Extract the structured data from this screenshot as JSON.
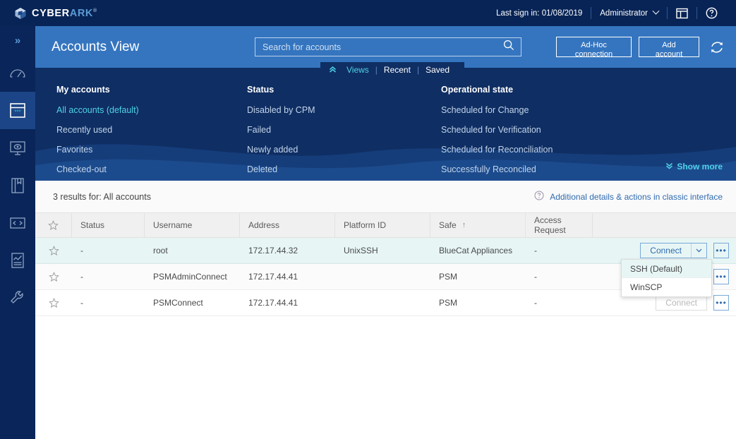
{
  "brand": {
    "name_white": "CYBER",
    "name_accent": "ARK",
    "trademark": "®",
    "accent_color": "#5b9bd5",
    "bar_color": "#082456"
  },
  "topbar": {
    "last_sign_in": "Last sign in: 01/08/2019",
    "user": "Administrator",
    "layout_icon": "panel-layout-icon",
    "help_icon": "help-circle-icon"
  },
  "sidebar": {
    "expand_glyph": "»",
    "items": [
      {
        "name": "dashboard",
        "icon": "gauge-icon",
        "active": false
      },
      {
        "name": "accounts",
        "icon": "accounts-window-icon",
        "active": true
      },
      {
        "name": "monitoring",
        "icon": "monitor-eye-icon",
        "active": false
      },
      {
        "name": "reports",
        "icon": "book-icon",
        "active": false
      },
      {
        "name": "api",
        "icon": "code-brackets-icon",
        "active": false
      },
      {
        "name": "analytics",
        "icon": "chart-document-icon",
        "active": false
      },
      {
        "name": "tools",
        "icon": "wrench-icon",
        "active": false
      }
    ]
  },
  "header": {
    "title": "Accounts View",
    "accent_color": "#3575bf",
    "search": {
      "placeholder": "Search for accounts",
      "value": ""
    },
    "adhoc_button": "Ad-Hoc\nconnection",
    "adhoc_line1": "Ad-Hoc",
    "adhoc_line2": "connection",
    "add_line1": "Add",
    "add_line2": "account",
    "refresh_icon": "refresh-icon"
  },
  "tabs": {
    "items": [
      {
        "label": "Views",
        "active": true
      },
      {
        "label": "Recent",
        "active": false
      },
      {
        "label": "Saved",
        "active": false
      }
    ],
    "separator": "|",
    "active_color": "#4fd2e8"
  },
  "views_panel": {
    "background": "#0f2e63",
    "columns": [
      {
        "header": "My accounts",
        "items": [
          {
            "label": "All accounts (default)",
            "active": true
          },
          {
            "label": "Recently used",
            "active": false
          },
          {
            "label": "Favorites",
            "active": false
          },
          {
            "label": "Checked-out",
            "active": false
          }
        ]
      },
      {
        "header": "Status",
        "items": [
          {
            "label": "Disabled by CPM",
            "active": false
          },
          {
            "label": "Failed",
            "active": false
          },
          {
            "label": "Newly added",
            "active": false
          },
          {
            "label": "Deleted",
            "active": false
          }
        ]
      },
      {
        "header": "Operational state",
        "items": [
          {
            "label": "Scheduled for Change",
            "active": false
          },
          {
            "label": "Scheduled for Verification",
            "active": false
          },
          {
            "label": "Scheduled for Reconciliation",
            "active": false
          },
          {
            "label": "Successfully Reconciled",
            "active": false
          }
        ]
      }
    ],
    "show_more": "Show more"
  },
  "results": {
    "summary": "3 results  for: All accounts",
    "classic_link": "Additional details & actions in classic interface"
  },
  "table": {
    "columns": [
      {
        "key": "favorite",
        "label": "",
        "icon": "star-icon"
      },
      {
        "key": "status",
        "label": "Status"
      },
      {
        "key": "username",
        "label": "Username"
      },
      {
        "key": "address",
        "label": "Address"
      },
      {
        "key": "platform_id",
        "label": "Platform ID"
      },
      {
        "key": "safe",
        "label": "Safe",
        "sort": "↑"
      },
      {
        "key": "access_request",
        "label": "Access Request"
      },
      {
        "key": "actions",
        "label": ""
      }
    ],
    "rows": [
      {
        "status": "-",
        "username": "root",
        "address": "172.17.44.32",
        "platform_id": "UnixSSH",
        "safe": "BlueCat Appliances",
        "access_request": "-",
        "connect_label": "Connect",
        "connect_enabled": true,
        "selected": true,
        "more_label": "•••"
      },
      {
        "status": "-",
        "username": "PSMAdminConnect",
        "address": "172.17.44.41",
        "platform_id": "",
        "safe": "PSM",
        "access_request": "-",
        "connect_label": "",
        "connect_enabled": false,
        "selected": false,
        "more_label": "•••"
      },
      {
        "status": "-",
        "username": "PSMConnect",
        "address": "172.17.44.41",
        "platform_id": "",
        "safe": "PSM",
        "access_request": "-",
        "connect_label": "Connect",
        "connect_enabled": false,
        "selected": false,
        "more_label": "•••"
      }
    ]
  },
  "connect_dropdown": {
    "open": true,
    "options": [
      {
        "label": "SSH (Default)",
        "hover": true
      },
      {
        "label": "WinSCP",
        "hover": false
      }
    ]
  }
}
